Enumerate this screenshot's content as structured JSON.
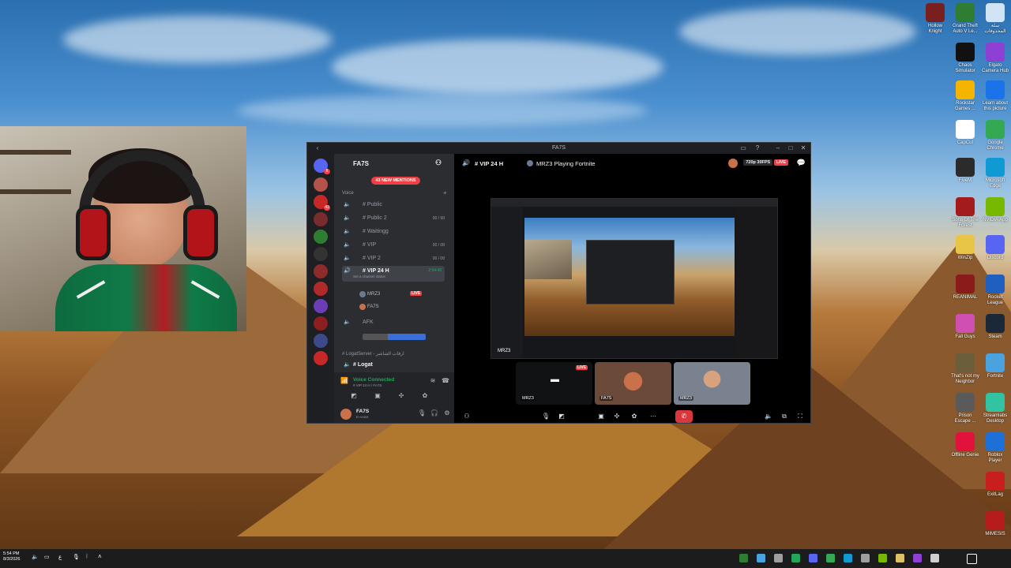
{
  "desktop": {
    "icons": [
      {
        "label": "Hollow Knight",
        "icon": "hollow-knight-icon",
        "color": "#7a1f1f"
      },
      {
        "label": "Grand Theft Auto V Le...",
        "icon": "gta-v-icon",
        "color": "#2e7d32"
      },
      {
        "label": "سلة المحذوفات",
        "icon": "recycle-bin-icon",
        "color": "#d0e4f5"
      },
      {
        "label": "Chaos Simulator",
        "icon": "chaos-simulator-icon",
        "color": "#111111"
      },
      {
        "label": "Elgato Camera Hub",
        "icon": "elgato-camera-hub-icon",
        "color": "#8e3fd4"
      },
      {
        "label": "Rockstar Games ...",
        "icon": "rockstar-games-icon",
        "color": "#f4b400"
      },
      {
        "label": "Learn about this picture",
        "icon": "learn-picture-icon",
        "color": "#1a73e8"
      },
      {
        "label": "CapCut",
        "icon": "capcut-icon",
        "color": "#ffffff"
      },
      {
        "label": "Google Chrome",
        "icon": "chrome-icon",
        "color": "#34a853"
      },
      {
        "label": "FiveM",
        "icon": "fivem-icon",
        "color": "#2b2b2b"
      },
      {
        "label": "Microsoft Edge",
        "icon": "edge-icon",
        "color": "#0f9ad3"
      },
      {
        "label": "Sons Of The Forest",
        "icon": "sons-of-the-forest-icon",
        "color": "#a31b1b"
      },
      {
        "label": "NVIDIA App",
        "icon": "nvidia-app-icon",
        "color": "#76b900"
      },
      {
        "label": "WinZip",
        "icon": "winzip-icon",
        "color": "#e8c547"
      },
      {
        "label": "Discord",
        "icon": "discord-icon",
        "color": "#5865f2"
      },
      {
        "label": "REANIMAL",
        "icon": "reanimal-icon",
        "color": "#8b1a1a"
      },
      {
        "label": "Rocket League",
        "icon": "rocket-league-icon",
        "color": "#1f5fbf"
      },
      {
        "label": "Fall Guys",
        "icon": "fall-guys-icon",
        "color": "#d04fb3"
      },
      {
        "label": "Steam",
        "icon": "steam-icon",
        "color": "#1b2838"
      },
      {
        "label": "That's not my Neighbor",
        "icon": "neighbor-icon",
        "color": "#6b5e3a"
      },
      {
        "label": "Fortnite",
        "icon": "fortnite-icon",
        "color": "#4aa3df"
      },
      {
        "label": "Prison Escape ...",
        "icon": "prison-escape-icon",
        "color": "#5a5a5a"
      },
      {
        "label": "Streamlabs Desktop",
        "icon": "streamlabs-icon",
        "color": "#31c3a2"
      },
      {
        "label": "Offline Genie",
        "icon": "offline-genie-icon",
        "color": "#e1123b"
      },
      {
        "label": "Roblox Player",
        "icon": "roblox-icon",
        "color": "#1d70d8"
      },
      {
        "label": "ExitLag",
        "icon": "exitlag-icon",
        "color": "#c81e1e"
      },
      {
        "label": "MIMESIS",
        "icon": "mimesis-icon",
        "color": "#b71c1c"
      }
    ]
  },
  "discord": {
    "window_title": "FA7S",
    "server_name": "FA7S",
    "mentions_pill": "43 NEW MENTIONS",
    "voice_category": "Voice",
    "channels": [
      {
        "name": "# Public",
        "count": ""
      },
      {
        "name": "# Public 2",
        "count": "00 / 99"
      },
      {
        "name": "# Waitingg",
        "count": ""
      },
      {
        "name": "# VIP",
        "count": "00 / 08"
      },
      {
        "name": "# VIP 2",
        "count": "00 / 08"
      }
    ],
    "active_channel": {
      "name": "# VIP 24 H",
      "timer": "2:54:48",
      "status": "Set a channel status"
    },
    "members": [
      {
        "name": "MRZ3",
        "live": "LIVE"
      },
      {
        "name": "FA7S",
        "live": ""
      }
    ],
    "afk_channel": "AFK",
    "category_2": "# LogatServer - ارقات الشاشر",
    "channel_logat": "# Logat",
    "voice_connected": "Voice Connected",
    "voice_sub": "# VIP 24 H / FA7S",
    "user_name": "FA7S",
    "user_status": "In voice",
    "stage_channel": "# VIP 24 H",
    "stage_activity": "MRZ3 Playing Fortnite",
    "quality": "720p 30FPS",
    "live": "LIVE",
    "stream_label": "MRZ3",
    "tiles": [
      {
        "name": "MRZ3",
        "live": "LIVE"
      },
      {
        "name": "FA7S"
      },
      {
        "name": "MRZ3"
      }
    ]
  },
  "taskbar": {
    "time": "5:54 PM",
    "date": "8/3/2026",
    "lang": "ع"
  }
}
